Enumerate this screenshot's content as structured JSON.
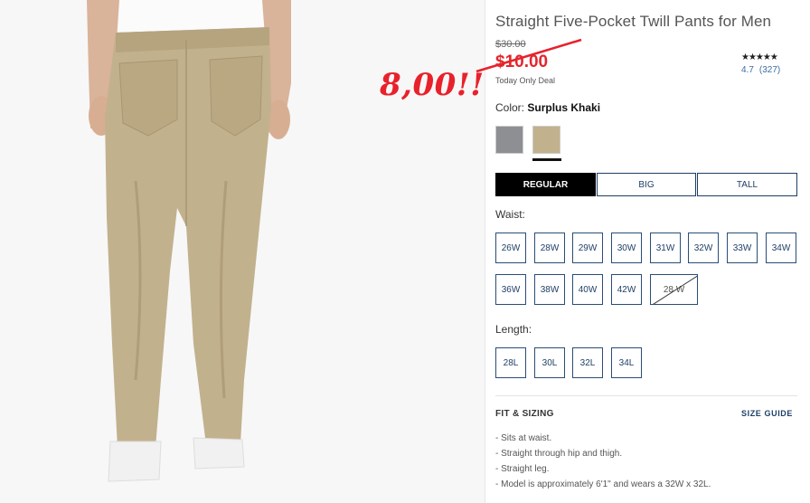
{
  "product": {
    "title": "Straight Five-Pocket Twill Pants for Men",
    "old_price": "$30.00",
    "price": "$10.00",
    "deal_text": "Today Only Deal",
    "stars": "★★★★★",
    "rating_value": "4.7",
    "rating_count": "(327)"
  },
  "annotation": {
    "text": "8,00!!",
    "color": "#e8212b"
  },
  "color": {
    "label": "Color:",
    "selected": "Surplus Khaki",
    "swatches": [
      {
        "name": "gray",
        "hex": "#8d8f93"
      },
      {
        "name": "Surplus Khaki",
        "hex": "#c2b18d",
        "selected": true
      }
    ]
  },
  "fit": {
    "options": [
      "REGULAR",
      "BIG",
      "TALL"
    ],
    "selected": "REGULAR"
  },
  "waist": {
    "label": "Waist:",
    "sizes": [
      "26W",
      "28W",
      "29W",
      "30W",
      "31W",
      "32W",
      "33W",
      "34W",
      "36W",
      "38W",
      "40W",
      "42W",
      "28 W"
    ],
    "unavailable": [
      "28 W"
    ]
  },
  "length": {
    "label": "Length:",
    "sizes": [
      "28L",
      "30L",
      "32L",
      "34L"
    ]
  },
  "fit_sizing": {
    "heading": "FIT & SIZING",
    "size_guide": "SIZE GUIDE",
    "bullets": [
      "Sits at waist.",
      "Straight through hip and thigh.",
      "Straight leg.",
      "Model is approximately 6'1\" and wears a 32W x 32L."
    ]
  },
  "colors": {
    "price_red": "#e3262d",
    "link_blue": "#1e3f66",
    "selected_black": "#000000"
  }
}
